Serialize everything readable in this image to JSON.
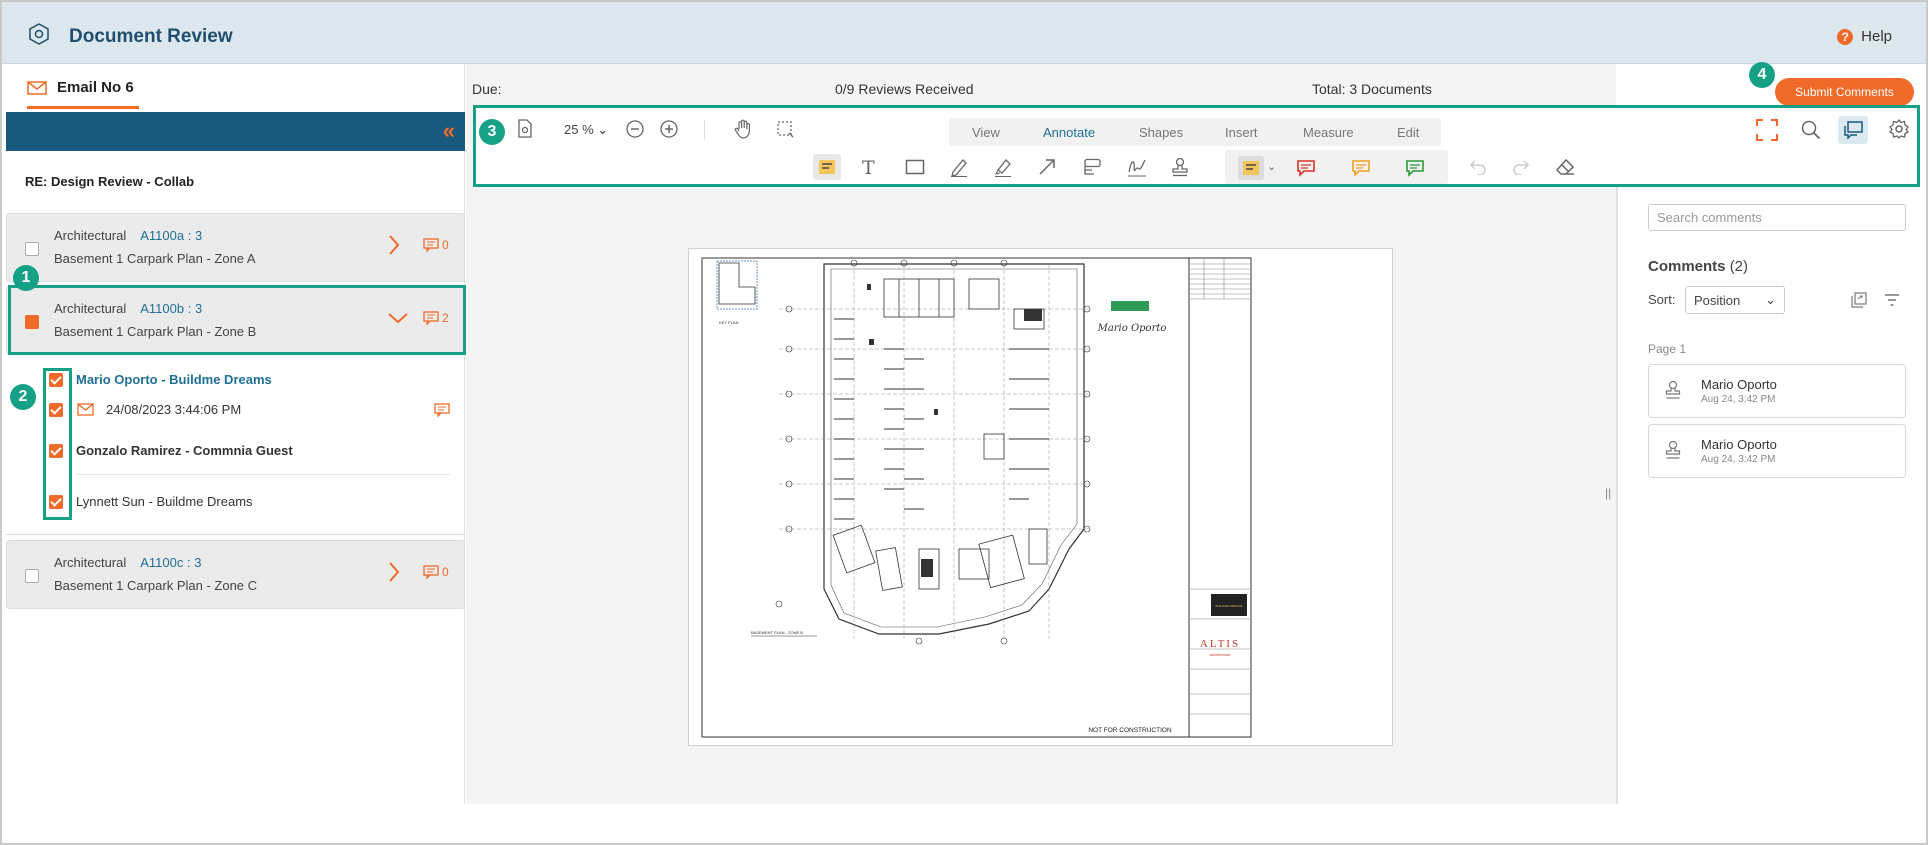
{
  "app": {
    "title": "Document Review",
    "help_label": "Help"
  },
  "left_panel": {
    "tab_label": "Email No 6",
    "subject": "RE: Design Review - Collab",
    "documents": [
      {
        "discipline": "Architectural",
        "code": "A1100a : 3",
        "name": "Basement 1 Carpark Plan - Zone A",
        "comments": "0",
        "checked": false,
        "expanded": false
      },
      {
        "discipline": "Architectural",
        "code": "A1100b : 3",
        "name": "Basement 1 Carpark Plan - Zone B",
        "comments": "2",
        "checked": true,
        "expanded": true
      },
      {
        "discipline": "Architectural",
        "code": "A1100c : 3",
        "name": "Basement 1 Carpark Plan - Zone C",
        "comments": "0",
        "checked": false,
        "expanded": false
      }
    ],
    "reviewers": [
      {
        "name": "Mario Oporto - Buildme Dreams"
      },
      {
        "date": "24/08/2023 3:44:06 PM"
      },
      {
        "name": "Gonzalo Ramirez - Commnia Guest"
      },
      {
        "name": "Lynnett Sun - Buildme Dreams"
      }
    ]
  },
  "status": {
    "due": "Due:",
    "reviews": "0/9 Reviews Received",
    "total": "Total: 3 Documents"
  },
  "toolbar": {
    "zoom": "25 %",
    "menu": [
      "View",
      "Annotate",
      "Shapes",
      "Insert",
      "Measure",
      "Edit"
    ],
    "active_menu": "Annotate",
    "submit_label": "Submit Comments"
  },
  "annotations": [
    "1",
    "2",
    "3",
    "4"
  ],
  "drawing": {
    "stamp": "NOT FOR CONSTRUCTION",
    "signature": "Mario Oporto",
    "brand": "ALTIS",
    "brand_sub": "architecture",
    "plan_label": "BASEMENT PLAN - ZONE B",
    "key_plan": "KEY PLAN"
  },
  "right_panel": {
    "search_placeholder": "Search comments",
    "comments_title": "Comments",
    "comments_count": "(2)",
    "sort_label": "Sort:",
    "sort_value": "Position",
    "page_label": "Page 1",
    "comments": [
      {
        "author": "Mario Oporto",
        "time": "Aug 24, 3:42 PM"
      },
      {
        "author": "Mario Oporto",
        "time": "Aug 24, 3:42 PM"
      }
    ]
  },
  "colors": {
    "accent": "#f06a2a",
    "annotation": "#16a085",
    "brand_blue": "#185a7d",
    "title": "#1f4e6e"
  }
}
